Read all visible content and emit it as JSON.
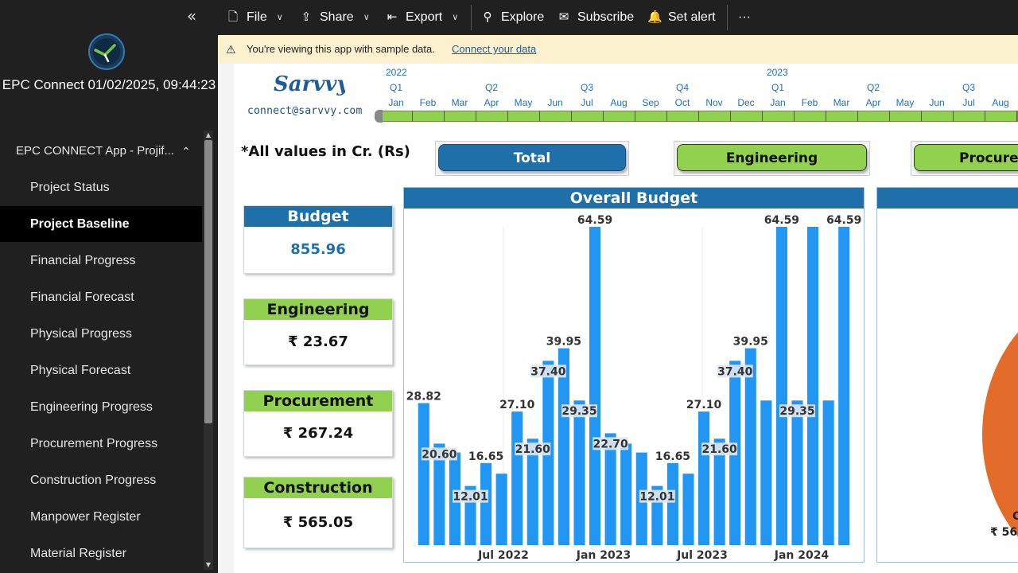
{
  "sidebar": {
    "collapse_icon": "«",
    "app_title": "EPC Connect 01/02/2025, 09:44:23",
    "nav_group": {
      "label": "EPC CONNECT App - Projif...",
      "chevron": "^"
    },
    "items": [
      {
        "label": "Project Status"
      },
      {
        "label": "Project Baseline",
        "active": true
      },
      {
        "label": "Financial Progress"
      },
      {
        "label": "Financial Forecast"
      },
      {
        "label": "Physical Progress"
      },
      {
        "label": "Physical Forecast"
      },
      {
        "label": "Engineering Progress"
      },
      {
        "label": "Procurement Progress"
      },
      {
        "label": "Construction Progress"
      },
      {
        "label": "Manpower Register"
      },
      {
        "label": "Material Register"
      }
    ]
  },
  "toolbar": {
    "file": "File",
    "share": "Share",
    "export": "Export",
    "explore": "Explore",
    "subscribe": "Subscribe",
    "set_alert": "Set alert",
    "more": "···"
  },
  "notice": {
    "message": "You're viewing this app with sample data.",
    "link": "Connect your data"
  },
  "brand": {
    "logo_text": "Sarvvy",
    "email": "connect@sarvvy.com"
  },
  "timeline": {
    "years": [
      "2022",
      "2023"
    ],
    "quarters": [
      "Q1",
      "Q2",
      "Q3",
      "Q4",
      "Q1",
      "Q2",
      "Q3"
    ],
    "months": [
      "Jan",
      "Feb",
      "Mar",
      "Apr",
      "May",
      "Jun",
      "Jul",
      "Aug",
      "Sep",
      "Oct",
      "Nov",
      "Dec",
      "Jan",
      "Feb",
      "Mar",
      "Apr",
      "May",
      "Jun",
      "Jul",
      "Aug"
    ]
  },
  "note": "*All values in Cr. (Rs)",
  "slicers": [
    "Total",
    "Engineering",
    "Procure"
  ],
  "cards": {
    "budget": {
      "title": "Budget",
      "value": "855.96"
    },
    "engineering": {
      "title": "Engineering",
      "value": "₹ 23.67"
    },
    "procurement": {
      "title": "Procurement",
      "value": "₹ 267.24"
    },
    "construction": {
      "title": "Construction",
      "value": "₹ 565.05"
    }
  },
  "colors": {
    "accent_blue": "#1f6fa8",
    "accent_green": "#92d050",
    "bar_blue": "#2196f3",
    "pie_orange": "#e46c2a"
  },
  "chart_data": {
    "type": "bar",
    "title": "Overall Budget",
    "x_tick_labels": [
      "Jul 2022",
      "Jan 2023",
      "Jul 2023",
      "Jan 2024"
    ],
    "values": [
      28.82,
      20.6,
      18.8,
      12.01,
      16.65,
      14.5,
      27.1,
      21.6,
      37.4,
      39.95,
      29.35,
      64.59,
      22.7,
      20.6,
      18.8,
      12.01,
      16.65,
      14.5,
      27.1,
      21.6,
      37.4,
      39.95,
      29.35,
      64.59,
      29.35,
      64.59,
      29.35,
      64.59
    ],
    "data_labels": [
      "28.82",
      "20.60",
      "",
      "12.01",
      "16.65",
      "",
      "27.10",
      "21.60",
      "37.40",
      "39.95",
      "29.35",
      "64.59",
      "22.70",
      "",
      "",
      "12.01",
      "16.65",
      "",
      "27.10",
      "21.60",
      "37.40",
      "39.95",
      "",
      "64.59",
      "29.35",
      "",
      "",
      "64.59"
    ],
    "ylim": [
      0,
      64.59
    ],
    "grid": false,
    "legend": "none"
  },
  "pie_labels": {
    "line1": "C",
    "line2": "₹ 56"
  }
}
